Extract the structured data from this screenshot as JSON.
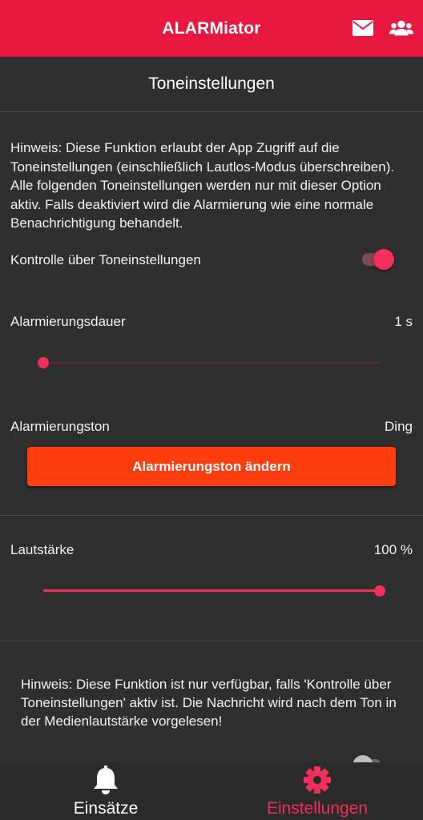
{
  "app": {
    "title": "ALARMiator",
    "actions": [
      {
        "name": "mail-icon",
        "icon": "envelope"
      },
      {
        "name": "group-icon",
        "icon": "users"
      }
    ],
    "accent_color": "#e8173f"
  },
  "page": {
    "title": "Toneinstellungen"
  },
  "hint_top": "Hinweis: Diese Funktion erlaubt der App Zugriff auf die Toneinstellungen (einschließlich Lautlos-Modus überschreiben). Alle folgenden Toneinstellungen werden nur mit dieser Option aktiv. Falls deaktiviert wird die Alarmierung wie eine normale Benachrichtigung behandelt.",
  "control_toggle": {
    "label": "Kontrolle über Toneinstellungen",
    "checked": true
  },
  "duration": {
    "label": "Alarmierungsdauer",
    "value_text": "1 s",
    "slider_fraction": 0.0
  },
  "tone": {
    "label": "Alarmierungston",
    "value": "Ding",
    "button_label": "Alarmierungston ändern"
  },
  "volume": {
    "label": "Lautstärke",
    "value_text": "100 %",
    "slider_fraction": 1.0
  },
  "hint_bottom": "Hinweis: Diese Funktion ist nur verfügbar, falls 'Kontrolle über Toneinstellungen' aktiv ist. Die Nachricht wird nach dem Ton in der Medienlautstärke vorgelesen!",
  "bottom_toggle": {
    "checked": false
  },
  "bottom_nav": {
    "items": [
      {
        "label": "Einsätze",
        "icon": "bell-icon",
        "active": false
      },
      {
        "label": "Einstellungen",
        "icon": "gear-icon",
        "active": true
      }
    ]
  }
}
